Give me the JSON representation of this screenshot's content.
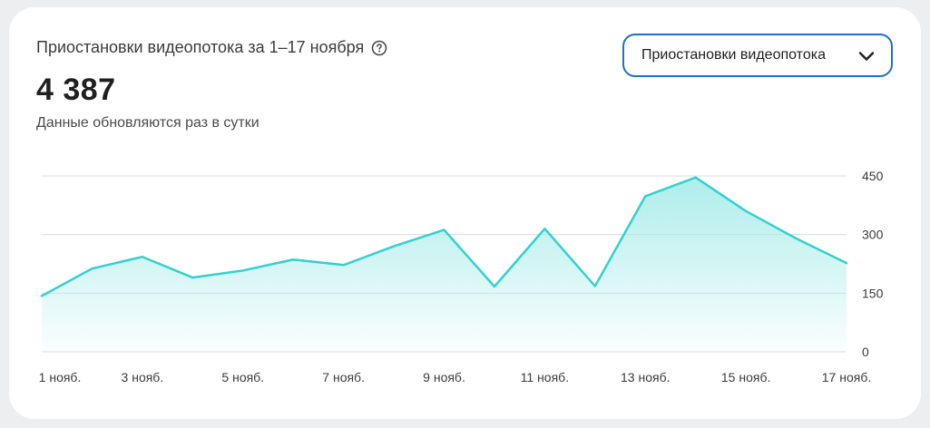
{
  "header": {
    "title": "Приостановки видеопотока за 1–17 ноября",
    "total": "4 387",
    "subtitle": "Данные обновляются раз в сутки",
    "help_icon": "question-circle-icon"
  },
  "dropdown": {
    "selected": "Приостановки видеопотока",
    "icon": "chevron-down-icon"
  },
  "colors": {
    "line": "#33d1cf",
    "fill_top": "#a9ecea",
    "grid": "#d9dcdf",
    "accent_border": "#1e6fd0"
  },
  "chart_data": {
    "type": "area",
    "x": [
      "1 нояб.",
      "2 нояб.",
      "3 нояб.",
      "4 нояб.",
      "5 нояб.",
      "6 нояб.",
      "7 нояб.",
      "8 нояб.",
      "9 нояб.",
      "10 нояб.",
      "11 нояб.",
      "12 нояб.",
      "13 нояб.",
      "14 нояб.",
      "15 нояб.",
      "16 нояб.",
      "17 нояб."
    ],
    "x_tick_labels": [
      "1 нояб.",
      "3 нояб.",
      "5 нояб.",
      "7 нояб.",
      "9 нояб.",
      "11 нояб.",
      "13 нояб.",
      "15 нояб.",
      "17 нояб."
    ],
    "series": [
      {
        "values": [
          143,
          213,
          243,
          190,
          208,
          236,
          222,
          270,
          312,
          167,
          315,
          168,
          398,
          446,
          360,
          290,
          227
        ]
      }
    ],
    "ylim": [
      0,
      450
    ],
    "yticks": [
      0,
      150,
      300,
      450
    ],
    "y_axis_side": "right",
    "grid": true,
    "title": "",
    "xlabel": "",
    "ylabel": ""
  }
}
